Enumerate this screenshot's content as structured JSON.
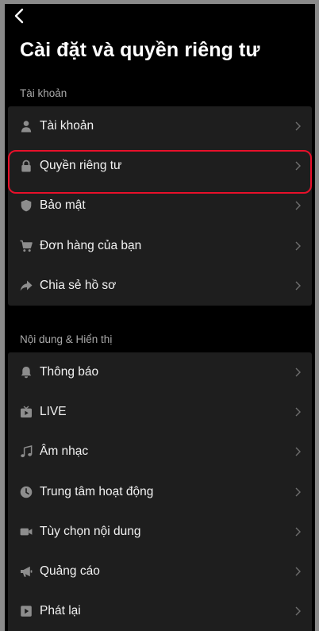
{
  "header": {
    "back_icon": "chevron-left-icon",
    "title": "Cài đặt và quyền riêng tư"
  },
  "sections": [
    {
      "label": "Tài khoản",
      "items": [
        {
          "label": "Tài khoản",
          "icon": "person-icon"
        },
        {
          "label": "Quyền riêng tư",
          "icon": "lock-icon",
          "highlighted": true
        },
        {
          "label": "Bảo mật",
          "icon": "shield-icon"
        },
        {
          "label": "Đơn hàng của bạn",
          "icon": "cart-icon"
        },
        {
          "label": "Chia sẻ hồ sơ",
          "icon": "share-arrow-icon"
        }
      ]
    },
    {
      "label": "Nội dung & Hiển thị",
      "items": [
        {
          "label": "Thông báo",
          "icon": "bell-icon"
        },
        {
          "label": "LIVE",
          "icon": "live-tv-icon"
        },
        {
          "label": "Âm nhạc",
          "icon": "music-note-icon"
        },
        {
          "label": "Trung tâm hoạt động",
          "icon": "clock-icon"
        },
        {
          "label": "Tùy chọn nội dung",
          "icon": "video-camera-icon"
        },
        {
          "label": "Quảng cáo",
          "icon": "megaphone-icon"
        },
        {
          "label": "Phát lại",
          "icon": "play-square-icon"
        }
      ]
    }
  ],
  "colors": {
    "background": "#000000",
    "card": "#1e1e1e",
    "highlight": "#e8102a",
    "icon": "#8d8d8d"
  }
}
